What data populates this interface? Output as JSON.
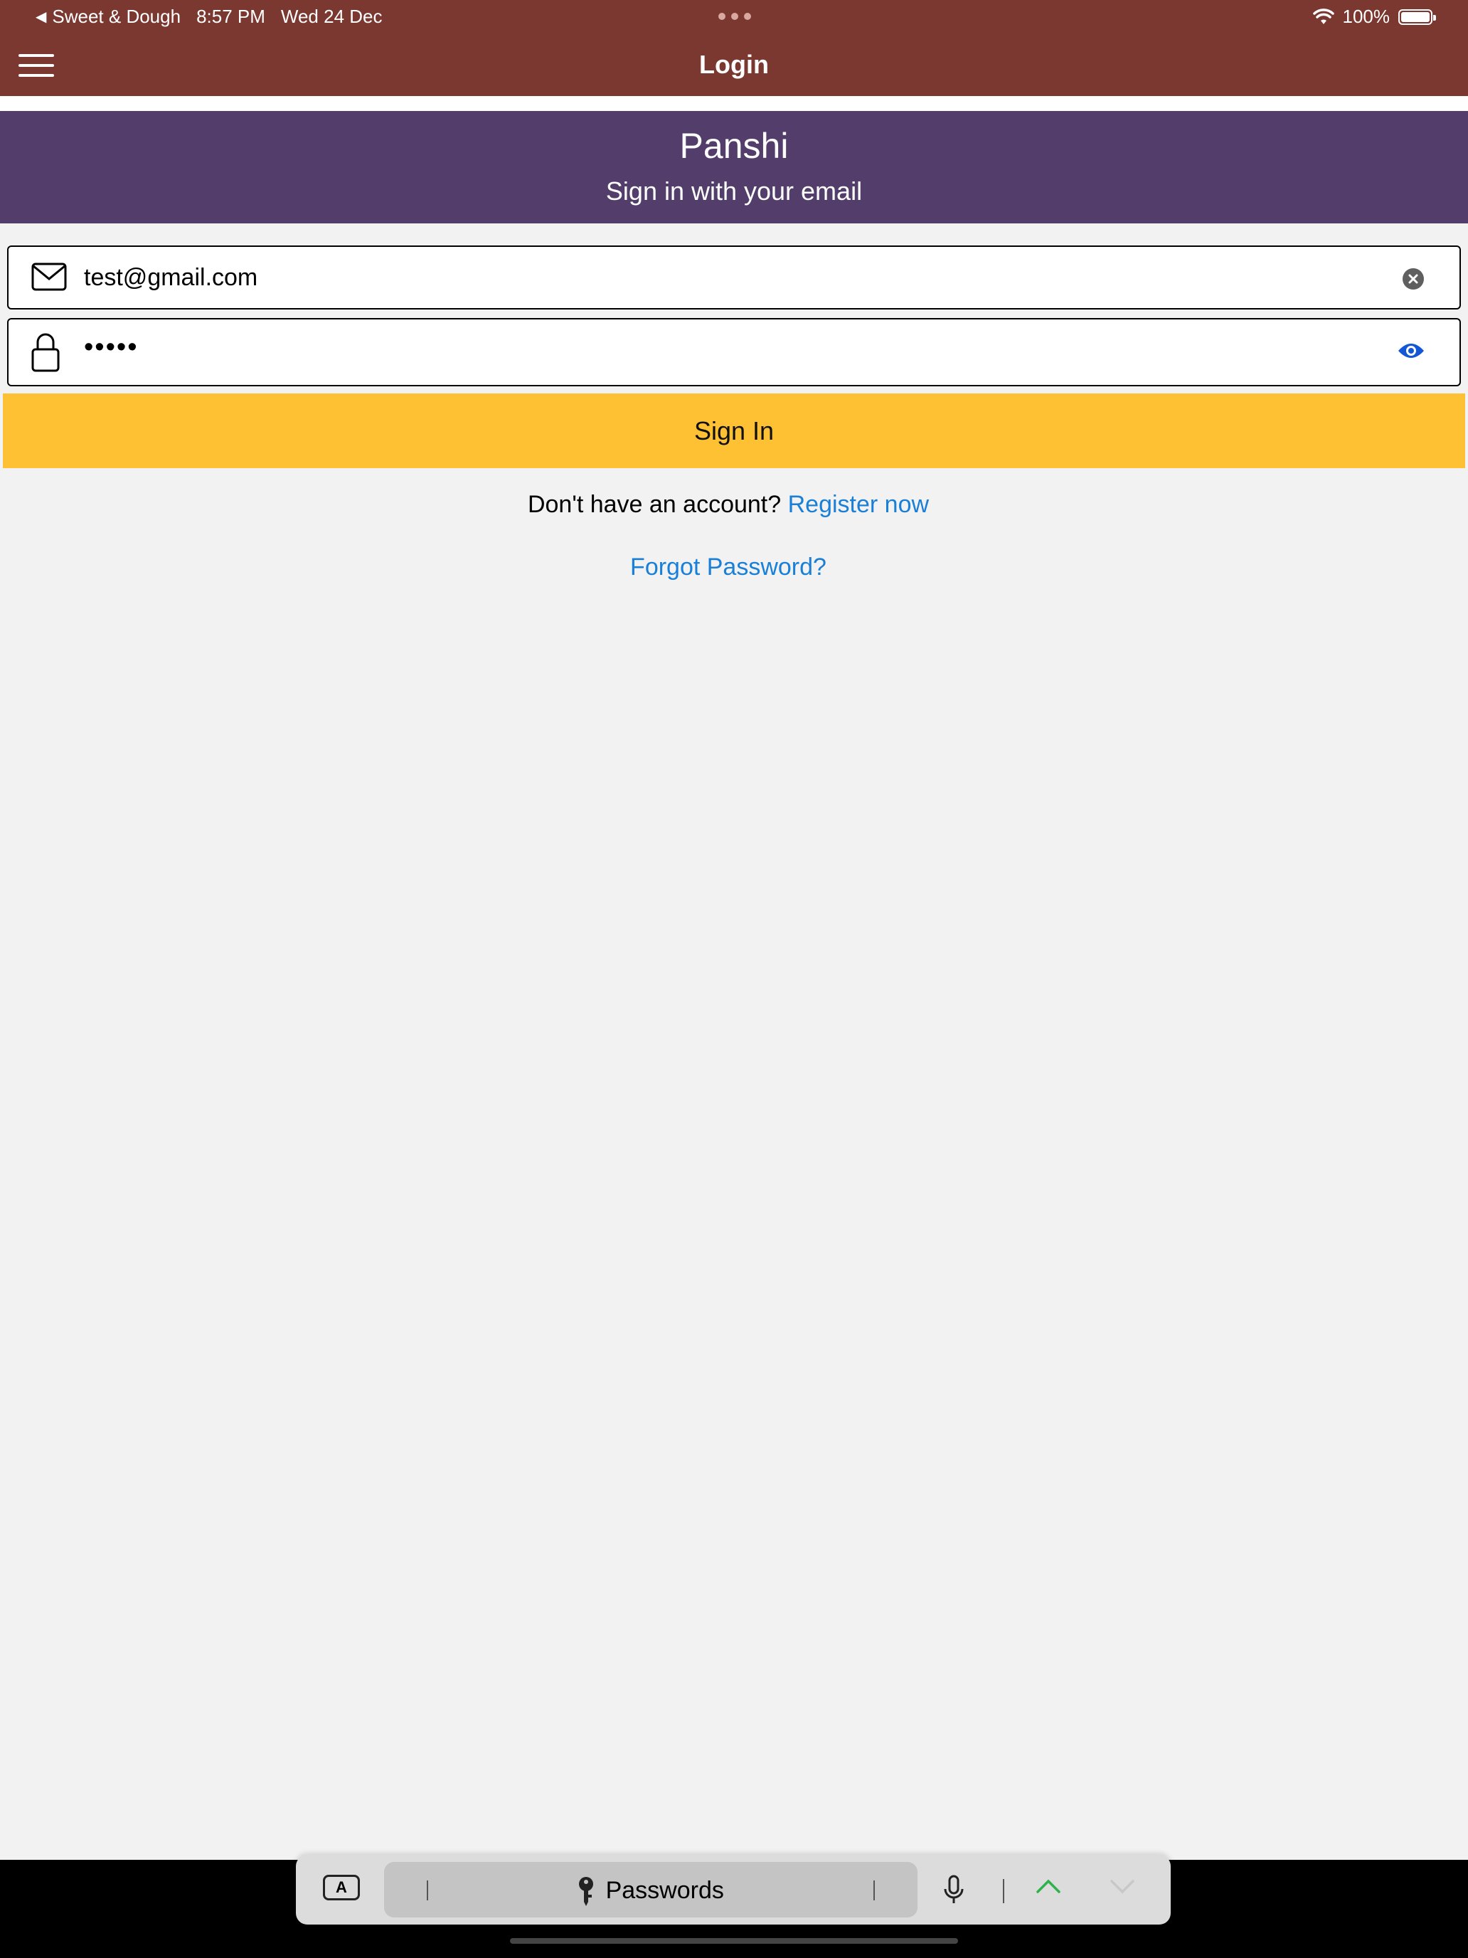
{
  "status_bar": {
    "back_app": "Sweet & Dough",
    "time": "8:57 PM",
    "date": "Wed 24 Dec",
    "battery": "100%"
  },
  "nav": {
    "title": "Login",
    "icons": [
      "hamburger-menu-icon"
    ]
  },
  "banner": {
    "title": "Panshi",
    "subtitle": "Sign in with your email",
    "color": "#533d6b"
  },
  "form": {
    "email_value": "test@gmail.com",
    "password_value": "•••••",
    "sign_in_label": "Sign In",
    "accent_color": "#ffc134"
  },
  "links": {
    "no_account_text": "Don't have an account?",
    "register_label": "Register now",
    "forgot_label": "Forgot Password?",
    "link_color": "#1a7fd6"
  },
  "keyboard_toolbar": {
    "keyboard_key": "A",
    "passwords_label": "Passwords"
  },
  "colors": {
    "header": "#7a3830",
    "background": "#f2f2f2"
  }
}
